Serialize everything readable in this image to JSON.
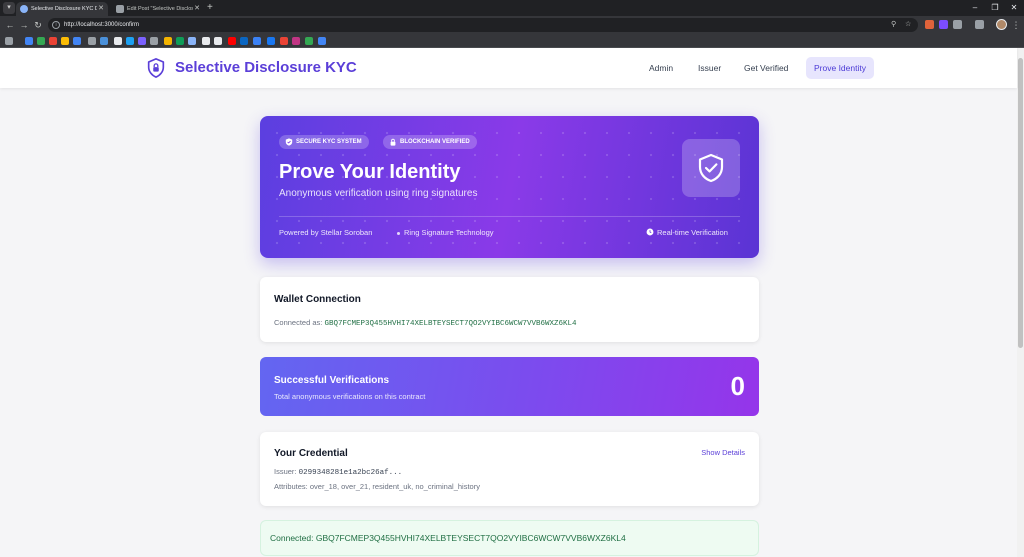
{
  "browser": {
    "tabs": [
      {
        "title": "Selective Disclosure KYC Demo",
        "active": true
      },
      {
        "title": "Edit Post \"Selective Disclosure ‹",
        "active": false
      }
    ],
    "url": "http://localhost:3000/confirm"
  },
  "header": {
    "brand": "Selective Disclosure KYC",
    "nav": [
      {
        "label": "Admin"
      },
      {
        "label": "Issuer"
      },
      {
        "label": "Get Verified"
      },
      {
        "label": "Prove Identity",
        "active": true
      }
    ]
  },
  "hero": {
    "badges": [
      "SECURE KYC SYSTEM",
      "BLOCKCHAIN VERIFIED"
    ],
    "title": "Prove Your Identity",
    "subtitle": "Anonymous verification using ring signatures",
    "footer_left": "Powered by Stellar Soroban",
    "footer_middle": "Ring Signature Technology",
    "footer_right": "Real-time Verification"
  },
  "wallet": {
    "title": "Wallet Connection",
    "connected_label": "Connected as:",
    "address": "GBQ7FCMEP3Q455HVHI74XELBTEYSECT7QO2VYIBC6WCW7VVB6WXZ6KL4"
  },
  "stats": {
    "title": "Successful Verifications",
    "subtitle": "Total anonymous verifications on this contract",
    "count": "0"
  },
  "credential": {
    "title": "Your Credential",
    "show_details": "Show Details",
    "issuer_label": "Issuer:",
    "issuer_value": "0299348281e1a2bc26af...",
    "attributes_label": "Attributes:",
    "attributes_value": "over_18, over_21, resident_uk, no_criminal_history"
  },
  "banner": {
    "text": "Connected: GBQ7FCMEP3Q455HVHI74XELBTEYSECT7QO2VYIBC6WCW7VVB6WXZ6KL4"
  },
  "colors": {
    "brand": "#5b3fd8",
    "hero_start": "#5b3fe0",
    "hero_mid": "#8a3ae8",
    "stats_start": "#6366f1",
    "stats_end": "#9535ea",
    "success_text": "#1f6e43",
    "success_bg": "#eefbf2"
  }
}
